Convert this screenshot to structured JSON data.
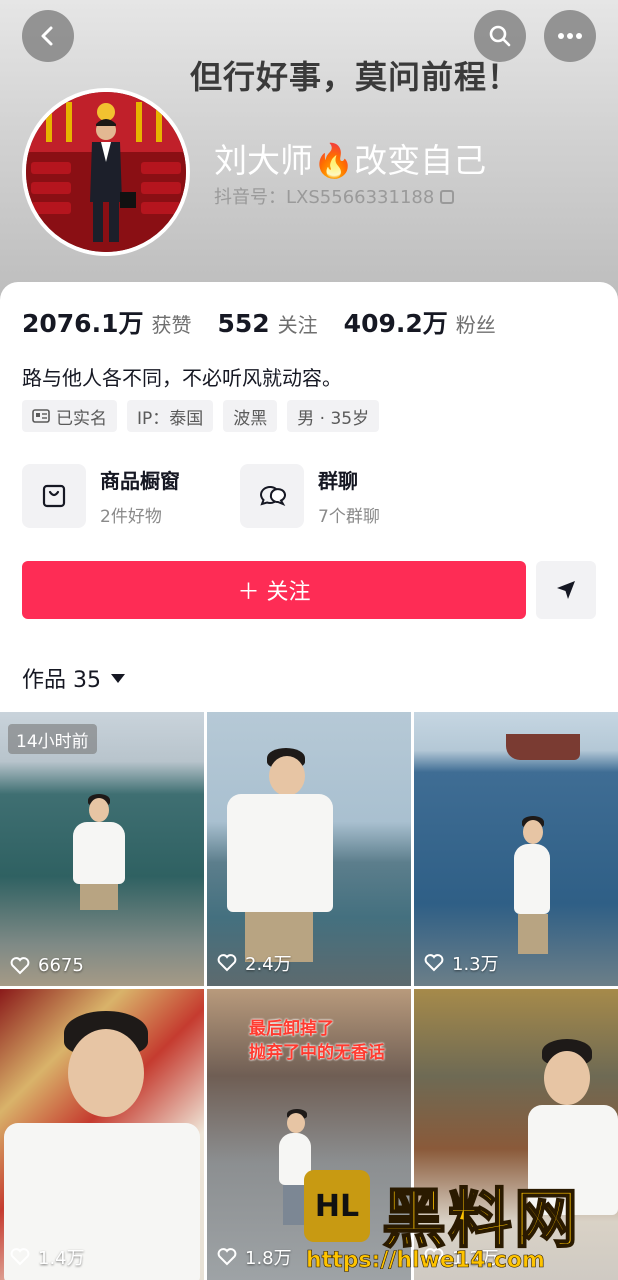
{
  "header": {
    "motto": "但行好事，莫问前程！",
    "nickname": "刘大师🔥改变自己",
    "douyin_id": "抖音号：LXS5566331188"
  },
  "stats": [
    {
      "num": "2076.1万",
      "label": "获赞"
    },
    {
      "num": "552",
      "label": "关注"
    },
    {
      "num": "409.2万",
      "label": "粉丝"
    }
  ],
  "bio": "路与他人各不同，不必听风就动容。",
  "tags": [
    "已实名",
    "IP：泰国",
    "波黑",
    "男 · 35岁"
  ],
  "features": {
    "shop": {
      "title": "商品橱窗",
      "sub": "2件好物"
    },
    "group": {
      "title": "群聊",
      "sub": "7个群聊"
    }
  },
  "actions": {
    "follow_label": "＋ 关注"
  },
  "works": {
    "label": "作品 35"
  },
  "videos": [
    {
      "likes": "6675",
      "badge": "14小时前"
    },
    {
      "likes": "2.4万"
    },
    {
      "likes": "1.3万"
    },
    {
      "likes": "1.4万"
    },
    {
      "likes": "1.8万",
      "caption": "最后卸掉了\n抛弃了中的无香话"
    },
    {
      "likes": "1.3万"
    }
  ],
  "watermark": {
    "logo": "HL",
    "title": "黑料网",
    "url": "https://hlwe14.com"
  },
  "colors": {
    "accent": "#fe2c55",
    "watermark": "#ffc400"
  }
}
